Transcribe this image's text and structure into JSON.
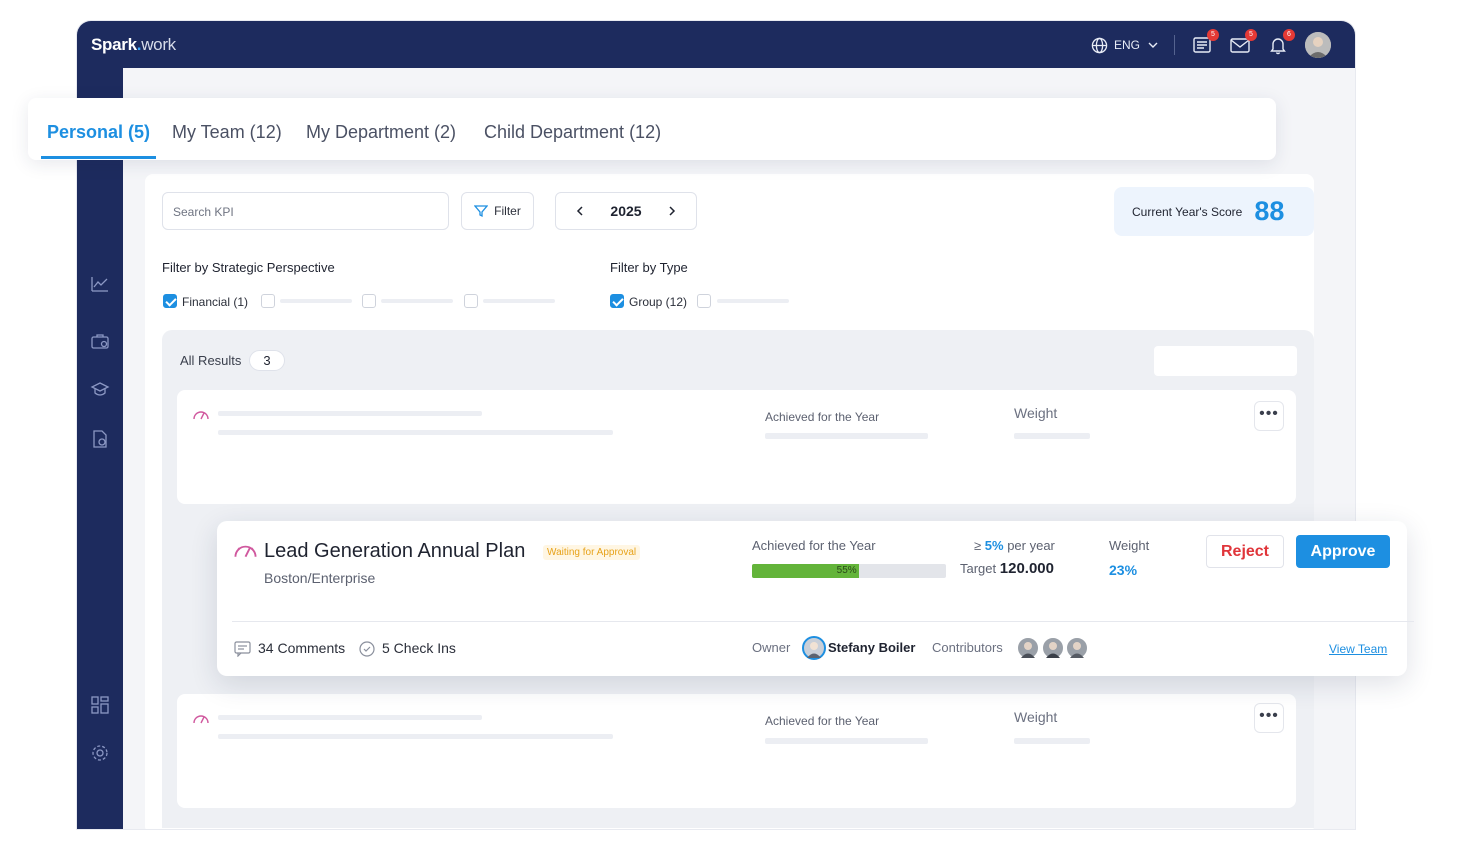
{
  "app": {
    "logo_main": "Spark",
    "logo_dot": ".",
    "logo_sub": "work"
  },
  "topbar": {
    "language": "ENG",
    "notifications": [
      {
        "icon": "list-icon",
        "count": "5"
      },
      {
        "icon": "mail-icon",
        "count": "5"
      },
      {
        "icon": "bell-icon",
        "count": "6"
      }
    ]
  },
  "tabs": [
    {
      "label": "Personal (5)",
      "active": true
    },
    {
      "label": "My Team (12)"
    },
    {
      "label": "My Department (2)"
    },
    {
      "label": "Child Department (12)"
    }
  ],
  "toolbar": {
    "search_placeholder": "Search KPI",
    "filter_label": "Filter",
    "year": "2025",
    "score_label": "Current Year's Score",
    "score_value": "88"
  },
  "filters": {
    "perspective_title": "Filter by Strategic Perspective",
    "perspective_option": "Financial (1)",
    "type_title": "Filter by Type",
    "type_option": "Group (12)"
  },
  "results": {
    "label": "All Results",
    "count": "3"
  },
  "placeholder_card": {
    "achieved_label": "Achieved for the Year",
    "weight_label": "Weight",
    "more": "•••"
  },
  "kpi": {
    "title": "Lead Generation Annual Plan",
    "status": "Waiting for Approval",
    "subtitle": "Boston/Enterprise",
    "achieved_label": "Achieved for the Year",
    "progress_label": "55%",
    "progress_value": 0.55,
    "goal_prefix": "≥",
    "goal_value": "5%",
    "goal_suffix": "per year",
    "target_label": "Target",
    "target_value": "120.000",
    "weight_label": "Weight",
    "weight_value": "23%",
    "reject_label": "Reject",
    "approve_label": "Approve",
    "comments": "34 Comments",
    "checkins": "5 Check Ins",
    "owner_label": "Owner",
    "owner_name": "Stefany Boiler",
    "contributors_label": "Contributors",
    "view_team": "View Team"
  },
  "colors": {
    "accent": "#1d8fe1",
    "nav": "#1d2b5e",
    "reject": "#e0353a",
    "progress": "#63b43a",
    "status": "#e7a21a"
  }
}
